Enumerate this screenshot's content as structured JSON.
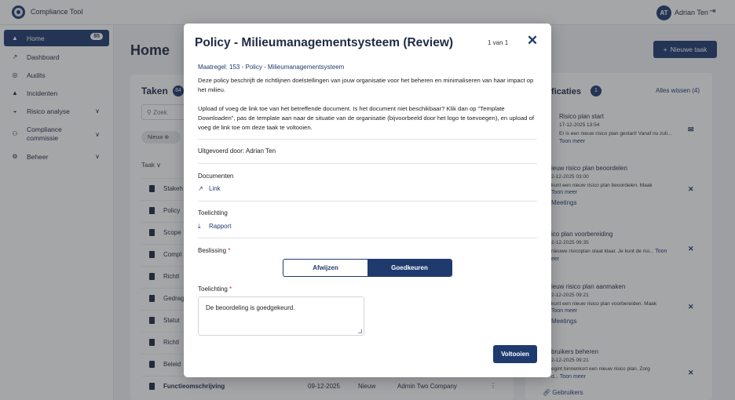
{
  "app": {
    "title": "Compliance Tool"
  },
  "user": {
    "initials": "AT",
    "name": "Adrian Ten"
  },
  "sidebar": {
    "items": [
      {
        "label": "Home",
        "badge": "85",
        "icon": "bell-icon"
      },
      {
        "label": "Dashboard",
        "icon": "chart-icon"
      },
      {
        "label": "Audits",
        "icon": "award-icon"
      },
      {
        "label": "Incidenten",
        "icon": "warning-icon"
      },
      {
        "label": "Risico analyse",
        "icon": "shield-icon"
      },
      {
        "label": "Compliance commissie",
        "icon": "users-icon"
      },
      {
        "label": "Beheer",
        "icon": "gear-icon"
      }
    ]
  },
  "main": {
    "page_title": "Home",
    "new_task_label": "Nieuwe taak",
    "tasks": {
      "title": "Taken",
      "count": "84",
      "search_placeholder": "Zoek",
      "filter_chip": "Nieuw",
      "col_head": "Taak",
      "rows": [
        {
          "name": "Stakeh"
        },
        {
          "name": "Policy"
        },
        {
          "name": "Scope"
        },
        {
          "name": "Compl"
        },
        {
          "name": "Richtl"
        },
        {
          "name": "Gedrag"
        },
        {
          "name": "Statut"
        },
        {
          "name": "Richtl"
        },
        {
          "name": "Beleid"
        },
        {
          "name": "Functieomschrijving",
          "date": "09-12-2025",
          "status": "Nieuw",
          "owner": "Admin Two Company"
        }
      ]
    },
    "notifications": {
      "title": "ificaties",
      "count": "1",
      "clear_label": "Alles wissen (4)",
      "items": [
        {
          "title": "Risico plan start",
          "date": "17-12-2025 13:54",
          "body": "Er is een nieuw risico plan gestart! Vanaf nu zull...",
          "more": "Toon meer"
        },
        {
          "title": "ieuw risico plan beoordelen",
          "date": "2-12-2025 03:00",
          "body": "kunt een nieuw risico plan beoordelen. Maak",
          "more": "Toon meer",
          "link": "Meetings"
        },
        {
          "title": "ico plan voorbereiding",
          "date": "2-12-2025 09:35",
          "body": "nieuwe risicoplan staat klaar. Je kunt de risi...",
          "more": "Toon",
          "extra": "eer"
        },
        {
          "title": "ieuw risico plan aanmaken",
          "date": "2-12-2025 09:21",
          "body": "kunt een nieuw risico plan voorbereiden. Maak",
          "more": "Toon meer",
          "link": "Meetings"
        },
        {
          "title": "bruikers beheren",
          "date": "2-12-2025 09:21",
          "body": "egint binnenkort een nieuw risico plan. Zorg",
          "body2": "d...",
          "more": "Toon meer",
          "link": "Gebruikers"
        }
      ]
    }
  },
  "modal": {
    "title": "Policy - Milieumanagementsysteem (Review)",
    "pager": "1 van 1",
    "measure": "Maatregel: 153 - Policy - Milieumanagementsysteem",
    "description": "Deze policy beschrijft de richtlijnen doelstellingen van jouw organisatie voor het beheren en minimaliseren van haar impact op het milieu.",
    "instructions": "Upload of voeg de link toe van het betreffende document. Is het document niet beschikbaar? Klik dan op \"Template Downloaden\", pas de template aan naar de situatie van de organisatie (bijvoorbeeld door het logo te toevoegen), en upload of voeg de link toe om deze taak te voltooien.",
    "performed_by": "Uitgevoerd door: Adrian Ten",
    "documents_label": "Documenten",
    "documents_link": "Link",
    "explanation_label": "Toelichting",
    "report_link": "Rapport",
    "decision_label": "Beslissing",
    "decision_reject": "Afwijzen",
    "decision_approve": "Goedkeuren",
    "decision_selected": "Goedkeuren",
    "comment_label": "Toelichting",
    "comment_value": "De beoordeling is goedgekeurd.",
    "required_mark": "*",
    "finish_label": "Voltooien",
    "close_symbol": "✕"
  }
}
